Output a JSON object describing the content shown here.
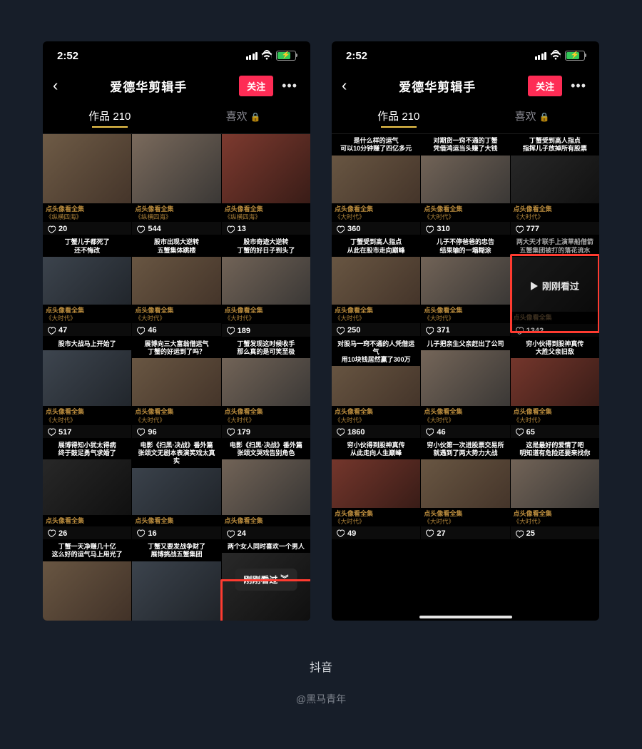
{
  "status": {
    "time": "2:52"
  },
  "nav": {
    "title": "爱德华剪辑手",
    "follow": "关注"
  },
  "tabs": {
    "works_label": "作品",
    "works_count": "210",
    "likes_label": "喜欢"
  },
  "captions": {
    "app": "抖音",
    "author": "@黑马青年"
  },
  "series_label": "点头像看全集",
  "just_watched": "刚刚看过",
  "left_cells": [
    {
      "likes": "20",
      "title": "",
      "sub": "《纵横四海》",
      "bg": "v2",
      "noband": false
    },
    {
      "likes": "544",
      "title": "",
      "sub": "《纵横四海》",
      "bg": "v3",
      "noband": false
    },
    {
      "likes": "13",
      "title": "",
      "sub": "《纵横四海》",
      "bg": "v5",
      "noband": false
    },
    {
      "likes": "47",
      "title": "丁蟹儿子都死了\n还不悔改",
      "sub": "《大时代》",
      "bg": "v4",
      "noband": false
    },
    {
      "likes": "46",
      "title": "股市出现大逆转\n五蟹集体跳楼",
      "sub": "《大时代》",
      "bg": "v2",
      "noband": false
    },
    {
      "likes": "189",
      "title": "股市奇迹大逆转\n丁蟹的好日子到头了",
      "sub": "《大时代》",
      "bg": "v3",
      "noband": false
    },
    {
      "likes": "517",
      "title": "股市大战马上开始了",
      "sub": "《大时代》",
      "bg": "v4",
      "noband": false
    },
    {
      "likes": "96",
      "title": "展博向三大富翁借运气\n丁蟹的好运到了吗？",
      "sub": "《大时代》",
      "bg": "v2",
      "noband": false
    },
    {
      "likes": "179",
      "title": "丁蟹发现这时候收手\n那么真的是可笑至极",
      "sub": "《大时代》",
      "bg": "v3",
      "noband": false
    },
    {
      "likes": "26",
      "title": "展博得知小犹太得病\n终于鼓足勇气求婚了",
      "sub": "",
      "bg": "v6",
      "noband": false
    },
    {
      "likes": "16",
      "title": "电影《扫黑·决战》番外篇\n张颂文无剧本表演笑戏太真实",
      "sub": "",
      "bg": "v4",
      "noband": false
    },
    {
      "likes": "24",
      "title": "电影《扫黑·决战》番外篇\n张颂文哭戏告别角色",
      "sub": "",
      "bg": "v3",
      "noband": false
    },
    {
      "likes": "",
      "title": "丁蟹一天净赚几十亿\n这么好的运气马上用光了",
      "sub": "",
      "bg": "v2",
      "noband": true
    },
    {
      "likes": "",
      "title": "丁蟹又要发战争财了\n展博挑战五蟹集团",
      "sub": "",
      "bg": "v4",
      "noband": true
    },
    {
      "likes": "",
      "title": "两个女人同时喜欢一个男人",
      "sub": "",
      "bg": "v6",
      "noband": true,
      "just_watched_chip": true
    }
  ],
  "right_cells": [
    {
      "likes": "360",
      "title": "是什么样的运气\n可以10分钟赚了四亿多元",
      "sub": "《大时代》",
      "bg": "v2",
      "noband": false
    },
    {
      "likes": "310",
      "title": "对期货一窍不通的丁蟹\n凭借鸿运当头赚了大钱",
      "sub": "《大时代》",
      "bg": "v3",
      "noband": false
    },
    {
      "likes": "777",
      "title": "丁蟹受到高人指点\n指挥儿子放掉所有股票",
      "sub": "《大时代》",
      "bg": "v6",
      "noband": false
    },
    {
      "likes": "250",
      "title": "丁蟹受到高人指点\n从此在股市走向巅峰",
      "sub": "《大时代》",
      "bg": "v2",
      "noband": false
    },
    {
      "likes": "371",
      "title": "儿子不停爸爸的忠告\n结果输的一塌糊涂",
      "sub": "《大时代》",
      "bg": "v3",
      "noband": false
    },
    {
      "likes": "1342",
      "title": "两大天才联手上演草船借箭\n五蟹集团被打的落花流水",
      "sub": "",
      "bg": "v6",
      "noband": false,
      "just_watched_inline": true,
      "dim_sub": true
    },
    {
      "likes": "1860",
      "title": "对股马一窍不通的人凭借运气\n用10块钱居然赢了300万",
      "sub": "《大时代》",
      "bg": "v2",
      "noband": false
    },
    {
      "likes": "46",
      "title": "儿子把亲生父亲赶出了公司",
      "sub": "《大时代》",
      "bg": "v3",
      "noband": false
    },
    {
      "likes": "65",
      "title": "穷小伙得到股神真传\n大胜父亲旧敌",
      "sub": "《大时代》",
      "bg": "v5",
      "noband": false
    },
    {
      "likes": "49",
      "title": "穷小伙得到股神真传\n从此走向人生巅峰",
      "sub": "《大时代》",
      "bg": "v5",
      "noband": false
    },
    {
      "likes": "27",
      "title": "穷小伙第一次进股票交易所\n就遇到了两大势力大战",
      "sub": "《大时代》",
      "bg": "v2",
      "noband": false
    },
    {
      "likes": "25",
      "title": "这是最好的爱情了吧\n明知道有危险还要来找你",
      "sub": "《大时代》",
      "bg": "v3",
      "noband": false
    }
  ]
}
